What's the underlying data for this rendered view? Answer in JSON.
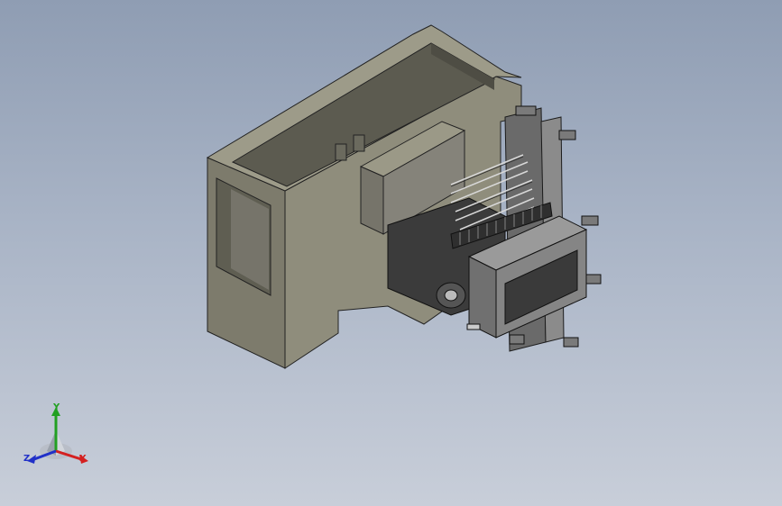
{
  "triad": {
    "x_label": "X",
    "y_label": "Y",
    "z_label": "Z",
    "x_color": "#d42020",
    "y_color": "#22a022",
    "z_color": "#2030c8"
  },
  "colors": {
    "background_top": "#8f9db3",
    "background_bottom": "#c8ced9",
    "frame_front": "#8c8a78",
    "frame_side": "#6f6d5e",
    "frame_top": "#a4a290",
    "frame_inner": "#5a594d",
    "machinery": "#3e3e3e",
    "machinery_light": "#8a8a8a"
  }
}
